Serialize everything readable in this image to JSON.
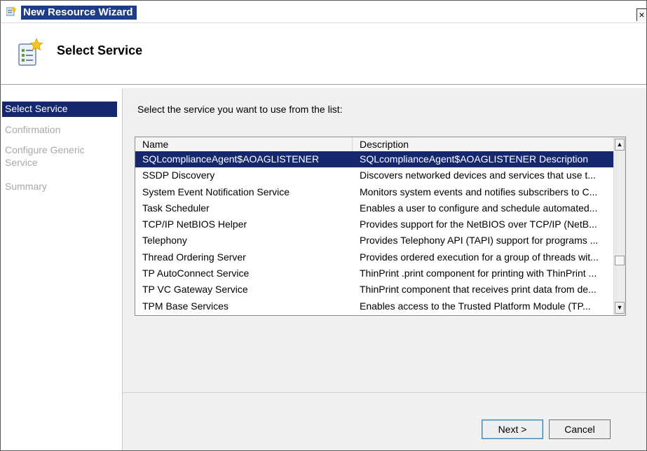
{
  "window": {
    "title": "New Resource Wizard",
    "close_glyph": "×"
  },
  "header": {
    "title": "Select Service",
    "icon": "wizard-icon"
  },
  "nav": {
    "items": [
      {
        "label": "Select Service",
        "active": true
      },
      {
        "label": "Confirmation",
        "active": false
      },
      {
        "label": "Configure Generic\nService",
        "active": false
      },
      {
        "label": "Summary",
        "active": false
      }
    ]
  },
  "main": {
    "instruction": "Select the service you want to use from the list:",
    "columns": {
      "name": "Name",
      "description": "Description"
    },
    "rows": [
      {
        "name": "SQLcomplianceAgent$AOAGLISTENER",
        "description": "SQLcomplianceAgent$AOAGLISTENER Description",
        "selected": true
      },
      {
        "name": "SSDP Discovery",
        "description": "Discovers networked devices and services that use t..."
      },
      {
        "name": "System Event Notification Service",
        "description": "Monitors system events and notifies subscribers to C..."
      },
      {
        "name": "Task Scheduler",
        "description": "Enables a user to configure and schedule automated..."
      },
      {
        "name": "TCP/IP NetBIOS Helper",
        "description": "Provides support for the NetBIOS over TCP/IP (NetB..."
      },
      {
        "name": "Telephony",
        "description": "Provides Telephony API (TAPI) support for programs ..."
      },
      {
        "name": "Thread Ordering Server",
        "description": "Provides ordered execution for a group of threads wit..."
      },
      {
        "name": "TP AutoConnect Service",
        "description": "ThinPrint .print component for printing with ThinPrint ..."
      },
      {
        "name": "TP VC Gateway Service",
        "description": "ThinPrint component that receives print data from de..."
      },
      {
        "name": "TPM Base Services",
        "description": "Enables access to the Trusted Platform Module (TP..."
      }
    ]
  },
  "buttons": {
    "next": "Next >",
    "cancel": "Cancel"
  },
  "scrollbar": {
    "up_glyph": "▲",
    "down_glyph": "▼"
  }
}
